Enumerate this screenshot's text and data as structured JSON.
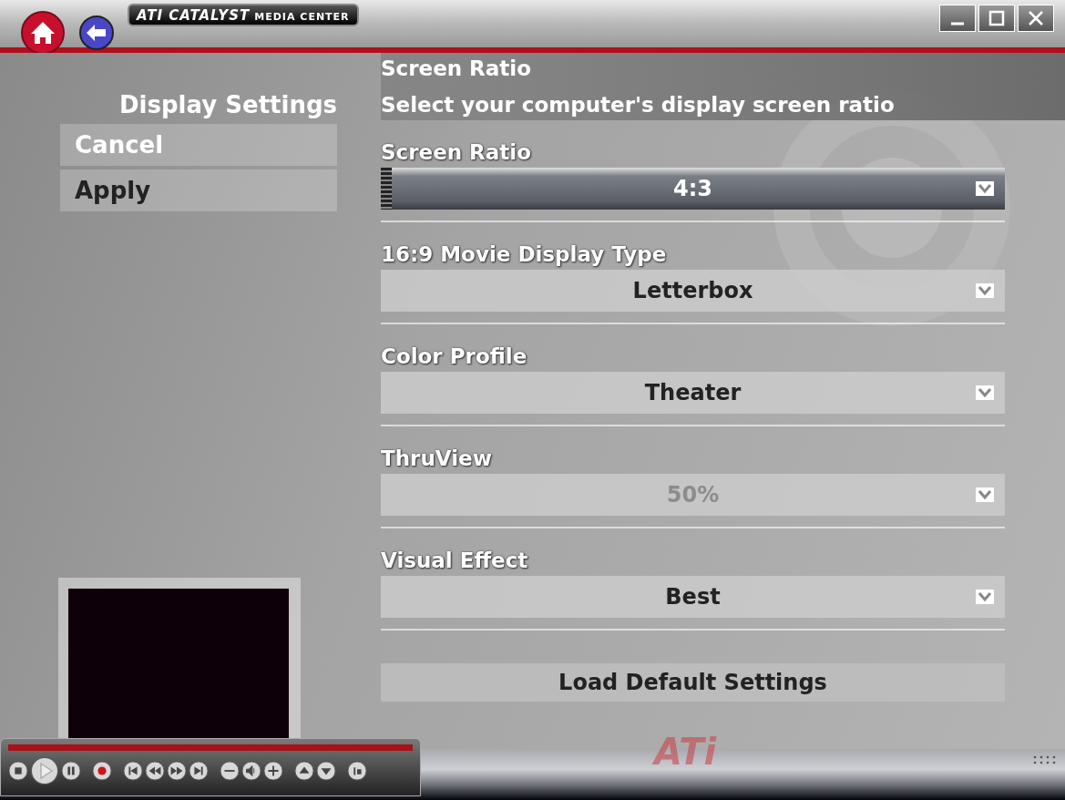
{
  "window": {
    "logo_left": "ATI CATALYST",
    "logo_right": "MEDIA CENTER",
    "controls": [
      {
        "kind": "minimize"
      },
      {
        "kind": "maximize"
      },
      {
        "kind": "close"
      }
    ]
  },
  "nav": [
    {
      "kind": "home"
    },
    {
      "kind": "back"
    }
  ],
  "sidebar": {
    "title": "Display Settings",
    "items": [
      {
        "label": "Cancel",
        "selected": false
      },
      {
        "label": "Apply",
        "selected": false
      }
    ]
  },
  "header": {
    "title": "Screen Ratio",
    "description": "Select your computer's display screen ratio"
  },
  "settings": [
    {
      "label": "Screen Ratio",
      "value": "4:3",
      "focused": true,
      "disabled": false
    },
    {
      "label": "16:9 Movie Display Type",
      "value": "Letterbox",
      "focused": false,
      "disabled": false
    },
    {
      "label": "Color Profile",
      "value": "Theater",
      "focused": false,
      "disabled": false
    },
    {
      "label": "ThruView",
      "value": "50%",
      "focused": false,
      "disabled": true
    },
    {
      "label": "Visual Effect",
      "value": "Best",
      "focused": false,
      "disabled": false
    }
  ],
  "default_button": "Load Default Settings",
  "watermark_logo": "ATi",
  "player": {
    "level": 1,
    "buttons": [
      {
        "kind": "stop"
      },
      {
        "kind": "play"
      },
      {
        "kind": "pause"
      },
      {
        "kind": "record"
      },
      {
        "kind": "prev"
      },
      {
        "kind": "rewind"
      },
      {
        "kind": "forward"
      },
      {
        "kind": "next"
      },
      {
        "kind": "vol-down"
      },
      {
        "kind": "mute"
      },
      {
        "kind": "vol-up"
      },
      {
        "kind": "up"
      },
      {
        "kind": "down"
      },
      {
        "kind": "info"
      }
    ]
  }
}
